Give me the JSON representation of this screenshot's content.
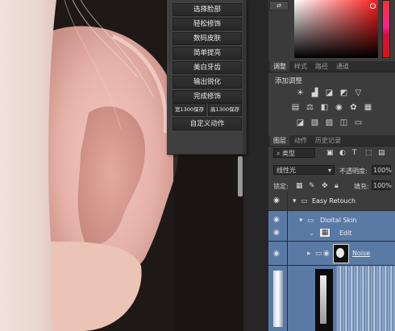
{
  "action_buttons": [
    {
      "label": "选择脸部"
    },
    {
      "label": "轻松修饰"
    },
    {
      "label": "数码皮肤"
    },
    {
      "label": "简单提亮"
    },
    {
      "label": "美白牙齿"
    },
    {
      "label": "输出锐化"
    },
    {
      "label": "完成修饰"
    },
    {
      "label": "宽1300保存"
    },
    {
      "label": "高1300保存"
    },
    {
      "label": "自定义动作"
    }
  ],
  "top_tabs": [
    "调整",
    "样式",
    "路径",
    "通道"
  ],
  "adjustments": {
    "title": "添加调整",
    "row1_icons": [
      "brightness-icon",
      "levels-icon",
      "curves-icon",
      "exposure-icon",
      "vibrance-icon"
    ],
    "row2_icons": [
      "hue-saturation-icon",
      "color-balance-icon",
      "black-white-icon",
      "photo-filter-icon",
      "channel-mixer-icon",
      "color-lookup-icon"
    ],
    "row3_icons": [
      "invert-icon",
      "posterize-icon",
      "threshold-icon",
      "selective-color-icon",
      "gradient-map-icon"
    ]
  },
  "layers_tabs": [
    "图层",
    "动作",
    "历史记录"
  ],
  "layers": {
    "filter_kind": "类型",
    "blend_mode": "线性光",
    "opacity_label": "不透明度:",
    "opacity_value": "100%",
    "lock_label": "锁定:",
    "fill_label": "填充:",
    "fill_value": "100%",
    "rows": [
      {
        "name": "Easy Retouch",
        "kind": "group",
        "selected": true
      },
      {
        "name": "Digital Skin",
        "kind": "group",
        "selected": true
      },
      {
        "name": "Edit",
        "kind": "layer",
        "selected": true
      },
      {
        "name": "Noise",
        "kind": "smart-layer",
        "selected": true
      }
    ]
  },
  "colors": {
    "selected_row": "#5a7aa6",
    "panel_bg": "#3c3c3c",
    "button_bg": "#2d2d2d"
  }
}
